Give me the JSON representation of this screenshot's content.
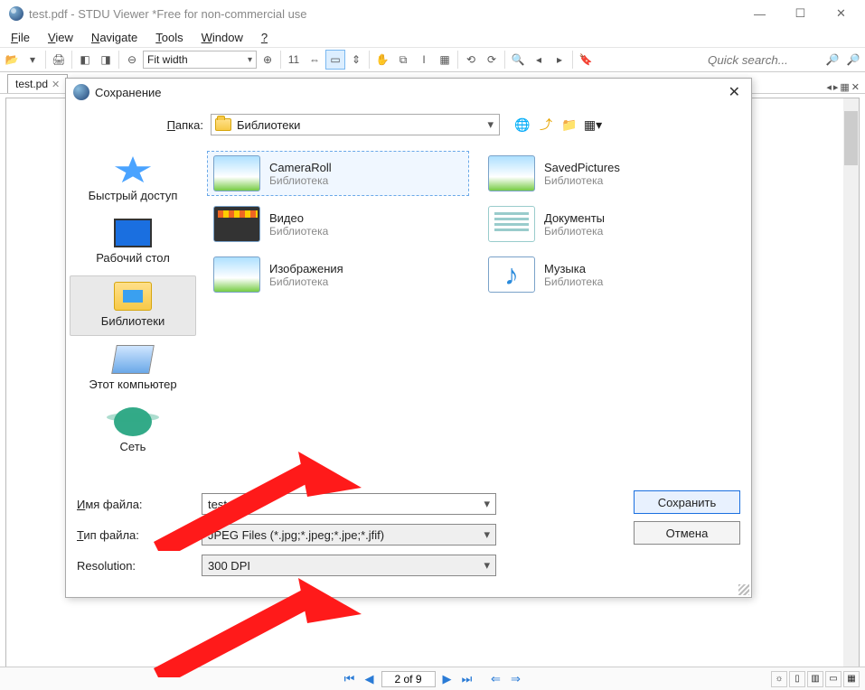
{
  "window": {
    "title": "test.pdf - STDU Viewer *Free for non-commercial use"
  },
  "menu": {
    "file": "File",
    "view": "View",
    "navigate": "Navigate",
    "tools": "Tools",
    "window": "Window",
    "help": "?"
  },
  "toolbar": {
    "zoom_mode": "Fit width",
    "quicksearch_placeholder": "Quick search...",
    "page_number": "11"
  },
  "tab": {
    "label": "test.pd"
  },
  "status": {
    "page_of": "2 of 9"
  },
  "dialog": {
    "title": "Сохранение",
    "folder_label": "Папка:",
    "folder_value": "Библиотеки",
    "places": {
      "quick": "Быстрый доступ",
      "desktop": "Рабочий стол",
      "libraries": "Библиотеки",
      "thispc": "Этот компьютер",
      "network": "Сеть"
    },
    "items": [
      {
        "name": "CameraRoll",
        "sub": "Библиотека"
      },
      {
        "name": "SavedPictures",
        "sub": "Библиотека"
      },
      {
        "name": "Видео",
        "sub": "Библиотека"
      },
      {
        "name": "Документы",
        "sub": "Библиотека"
      },
      {
        "name": "Изображения",
        "sub": "Библиотека"
      },
      {
        "name": "Музыка",
        "sub": "Библиотека"
      }
    ],
    "filename_label": "Имя файла:",
    "filename_value": "test_002",
    "filetype_label": "Тип файла:",
    "filetype_value": "JPEG Files (*.jpg;*.jpeg;*.jpe;*.jfif)",
    "resolution_label": "Resolution:",
    "resolution_value": "300 DPI",
    "save_label": "Сохранить",
    "cancel_label": "Отмена"
  }
}
